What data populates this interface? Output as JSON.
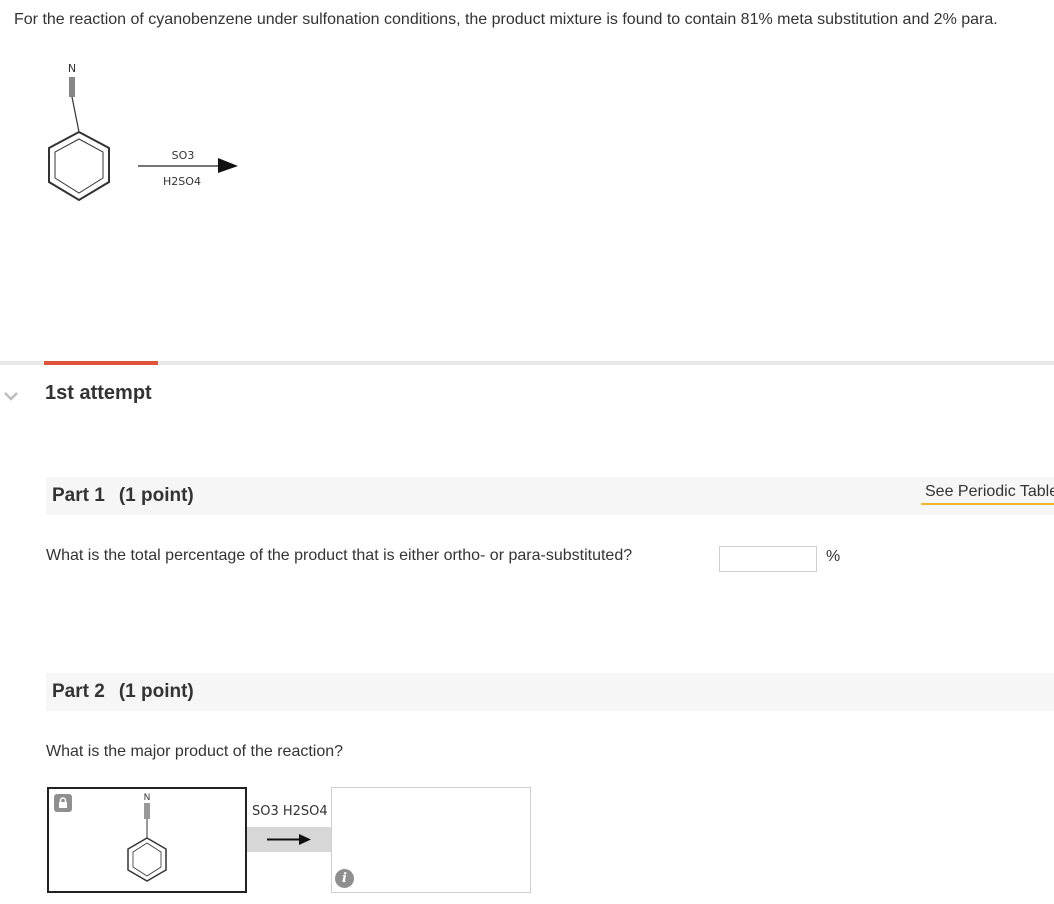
{
  "question": {
    "intro": "For the reaction of cyanobenzene under sulfonation conditions, the product mixture is found to contain 81% meta substitution and 2% para.",
    "reaction": {
      "starting_material_atom": "N",
      "reagent_above": "SO3",
      "reagent_below": "H2SO4"
    }
  },
  "attempt": {
    "label": "1st attempt"
  },
  "part1": {
    "title": "Part 1",
    "points": "(1 point)",
    "question": "What is the total percentage of the product that is either ortho- or para-substituted?",
    "input_value": "",
    "unit": "%"
  },
  "periodic_table": {
    "label": "See Periodic Table",
    "icon": "periodic-table-icon"
  },
  "part2": {
    "title": "Part 2",
    "points": "(1 point)",
    "question": "What is the major product of the reaction?",
    "reagents_label": "SO3 H2SO4",
    "starting_material_atom": "N"
  },
  "colors": {
    "accent": "#e0533b",
    "periodic_underline": "#f0b429",
    "part_bar": "#f6f6f6",
    "text": "#333333"
  }
}
